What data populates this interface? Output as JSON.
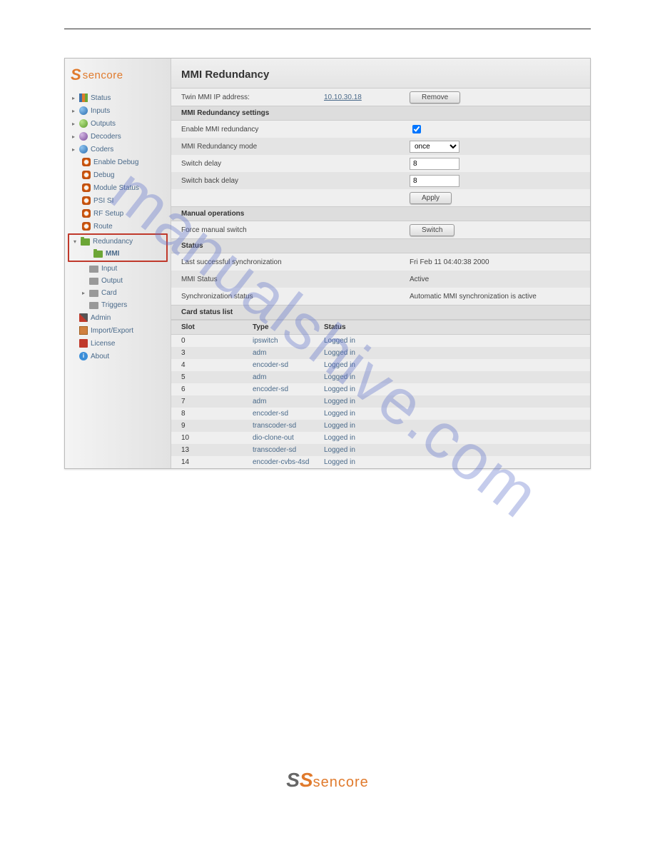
{
  "brand": "sencore",
  "page_title": "MMI Redundancy",
  "nav": {
    "status": "Status",
    "inputs": "Inputs",
    "outputs": "Outputs",
    "decoders": "Decoders",
    "coders": "Coders",
    "enable_debug": "Enable Debug",
    "debug": "Debug",
    "module_status": "Module Status",
    "psi_si": "PSI SI",
    "rf_setup": "RF Setup",
    "route": "Route",
    "redundancy": "Redundancy",
    "mmi": "MMI",
    "input": "Input",
    "output": "Output",
    "card": "Card",
    "triggers": "Triggers",
    "admin": "Admin",
    "import_export": "Import/Export",
    "license": "License",
    "about": "About"
  },
  "twin": {
    "label": "Twin MMI IP address:",
    "value": "10.10.30.18",
    "remove": "Remove"
  },
  "sect_settings": "MMI Redundancy settings",
  "settings": {
    "enable_label": "Enable MMI redundancy",
    "enable_checked": true,
    "mode_label": "MMI Redundancy mode",
    "mode_value": "once",
    "switch_delay_label": "Switch delay",
    "switch_delay_value": "8",
    "switch_back_label": "Switch back delay",
    "switch_back_value": "8",
    "apply": "Apply"
  },
  "sect_manual": "Manual operations",
  "manual": {
    "force_label": "Force manual switch",
    "switch": "Switch"
  },
  "sect_status": "Status",
  "status": {
    "last_sync_label": "Last successful synchronization",
    "last_sync_value": "Fri Feb 11 04:40:38 2000",
    "mmi_status_label": "MMI Status",
    "mmi_status_value": "Active",
    "sync_status_label": "Synchronization status",
    "sync_status_value": "Automatic MMI synchronization is active"
  },
  "sect_card": "Card status list",
  "cols": {
    "slot": "Slot",
    "type": "Type",
    "status": "Status"
  },
  "cards": [
    {
      "slot": "0",
      "type": "ipswitch",
      "status": "Logged in"
    },
    {
      "slot": "3",
      "type": "adm",
      "status": "Logged in"
    },
    {
      "slot": "4",
      "type": "encoder-sd",
      "status": "Logged in"
    },
    {
      "slot": "5",
      "type": "adm",
      "status": "Logged in"
    },
    {
      "slot": "6",
      "type": "encoder-sd",
      "status": "Logged in"
    },
    {
      "slot": "7",
      "type": "adm",
      "status": "Logged in"
    },
    {
      "slot": "8",
      "type": "encoder-sd",
      "status": "Logged in"
    },
    {
      "slot": "9",
      "type": "transcoder-sd",
      "status": "Logged in"
    },
    {
      "slot": "10",
      "type": "dio-clone-out",
      "status": "Logged in"
    },
    {
      "slot": "13",
      "type": "transcoder-sd",
      "status": "Logged in"
    },
    {
      "slot": "14",
      "type": "encoder-cvbs-4sd",
      "status": "Logged in"
    }
  ],
  "watermark": "manualshive.com"
}
